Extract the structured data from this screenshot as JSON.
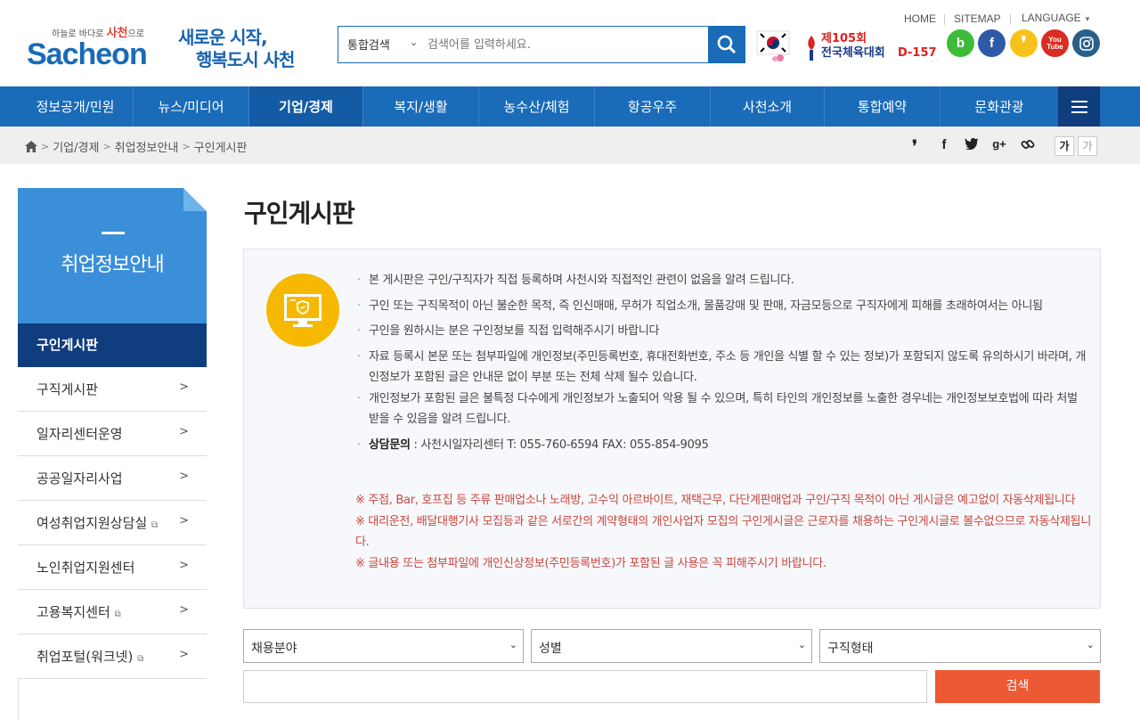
{
  "header": {
    "logo_top_left": "하늘로 바다로",
    "logo_top_name": "사천",
    "logo_top_right": "으로",
    "logo_main": "Sacheon",
    "slogan_line1": "새로운 시작,",
    "slogan_line2": "행복도시 사천",
    "search": {
      "select_value": "통합검색",
      "placeholder": "검색어를 입력하세요."
    },
    "event": {
      "line1": "제105회",
      "line2": "전국체육대회",
      "dday": "D-157"
    },
    "util": {
      "home": "HOME",
      "sitemap": "SITEMAP",
      "language": "LANGUAGE"
    },
    "sns": [
      {
        "name": "blog",
        "label": "b",
        "color": "#3dbb3a"
      },
      {
        "name": "facebook",
        "label": "f",
        "color": "#2c5aa8"
      },
      {
        "name": "kakaostory",
        "label": ",",
        "color": "#f7c31b"
      },
      {
        "name": "youtube",
        "label": "You Tube",
        "color": "#d82d22"
      },
      {
        "name": "instagram",
        "label": "◎",
        "color": "#2a5f8a"
      }
    ]
  },
  "gnb": {
    "items": [
      "정보공개/민원",
      "뉴스/미디어",
      "기업/경제",
      "복지/생활",
      "농수산/체험",
      "항공우주",
      "사천소개",
      "통합예약",
      "문화관광"
    ],
    "active_index": 2
  },
  "breadcrumb": [
    "기업/경제",
    "취업정보안내",
    "구인게시판"
  ],
  "fontsize": {
    "bigger": "가",
    "smaller": "가"
  },
  "sidebar": {
    "title": "취업정보안내",
    "active": "구인게시판",
    "items": [
      "구직게시판",
      "일자리센터운영",
      "공공일자리사업",
      "여성취업지원상담실",
      "노인취업지원센터",
      "고용복지센터",
      "취업포털(워크넷)"
    ]
  },
  "page": {
    "title": "구인게시판"
  },
  "notice": {
    "items": [
      "본 게시판은 구인/구직자가 직접 등록하며 사천시와 직접적인 관련이 없음을 알려 드립니다.",
      "구인 또는 구직목적이 아닌 불순한 목적, 즉 인신매매, 무허가 직업소개, 물품강매 및 판매, 자금모등으로 구직자에게 피해를 초래하여서는 아니됨",
      "구인을 원하시는 분은 구인정보를 직접 입력해주시기 바랍니다",
      "자료 등록시 본문 또는 첨부파일에 개인정보(주민등록번호, 휴대전화번호, 주소 등 개인을 식별 할 수 있는 정보)가 포함되지 않도록 유의하시기 바라며, 개인정보가 포함된 글은 안내문 없이 부분 또는 전체 삭제 될수 있습니다.",
      "개인정보가 포함된 글은 불특정 다수에게 개인정보가 노출되어 악용 될 수 있으며, 특히 타인의 개인정보를 노출한 경우네는 개인정보보호법에 따라 처벌 받을 수 있음을 알려 드립니다."
    ],
    "contact_label": "상담문의",
    "contact_text": " : 사천시일자리센터 T: 055-760-6594 FAX: 055-854-9095",
    "warnings": [
      "※ 주점, Bar, 호프집 등 주류 판매업소나 노래방, 고수익 아르바이트, 재택근무, 다단계판매업과 구인/구직 목적이 아닌 게시글은 예고없이 자동삭제됩니다",
      "※ 대리운전, 배달대행기사 모집등과 같은 서로간의 계약형태의 개인사업자 모집의 구인게시글은 근로자를 채용하는 구인게시글로 볼수없으므로 자동삭제됩니다.",
      "※ 글내용 또는 첨부파일에 개인신상정보(주민등록번호)가 포함된 글 사용은 꼭 피해주시기 바랍니다."
    ]
  },
  "filters": {
    "field": "채용분야",
    "gender": "성별",
    "type": "구직형태",
    "search_button": "검색"
  }
}
